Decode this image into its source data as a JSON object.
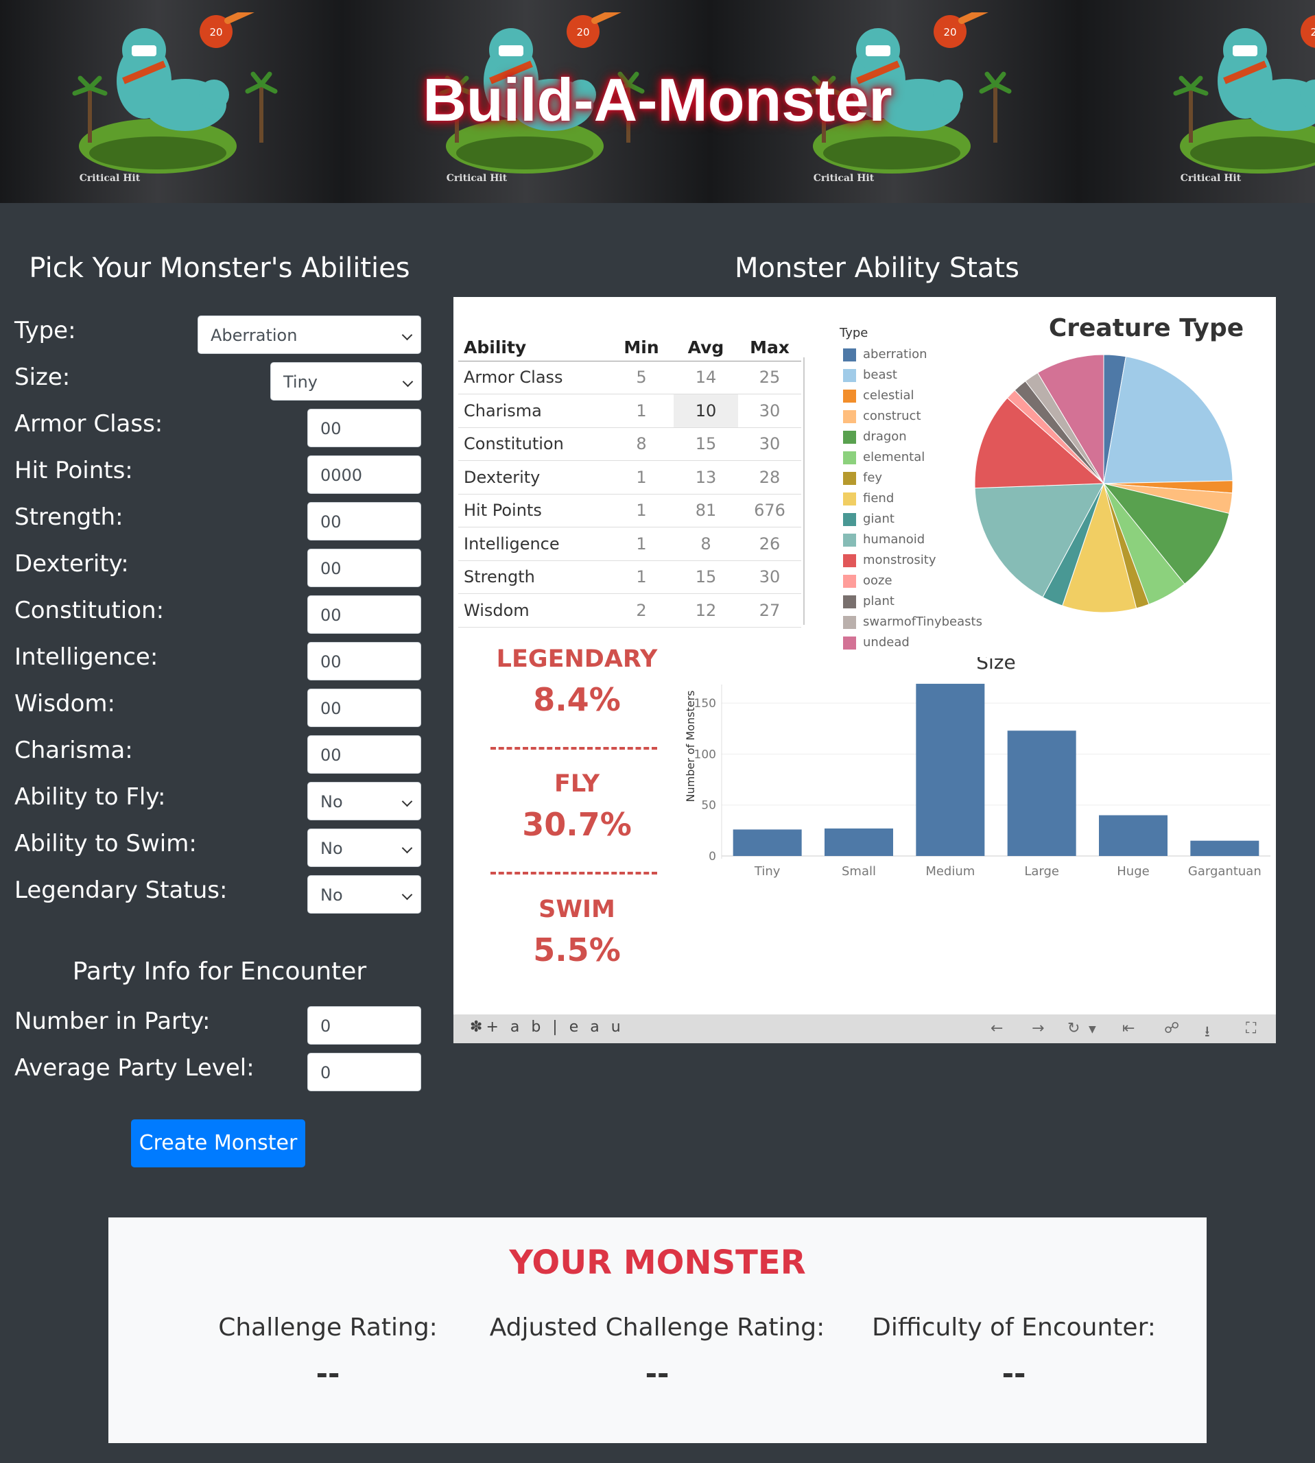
{
  "banner": {
    "title": "Build-A-Monster",
    "tile_caption": "Critical Hit",
    "die_label": "20"
  },
  "form": {
    "heading": "Pick Your Monster's Abilities",
    "fields": [
      {
        "label": "Type:",
        "value": "Aberration",
        "kind": "select"
      },
      {
        "label": "Size:",
        "value": "Tiny",
        "kind": "select"
      },
      {
        "label": "Armor Class:",
        "placeholder": "00",
        "kind": "input"
      },
      {
        "label": "Hit Points:",
        "placeholder": "0000",
        "kind": "input"
      },
      {
        "label": "Strength:",
        "placeholder": "00",
        "kind": "input"
      },
      {
        "label": "Dexterity:",
        "placeholder": "00",
        "kind": "input"
      },
      {
        "label": "Constitution:",
        "placeholder": "00",
        "kind": "input"
      },
      {
        "label": "Intelligence:",
        "placeholder": "00",
        "kind": "input"
      },
      {
        "label": "Wisdom:",
        "placeholder": "00",
        "kind": "input"
      },
      {
        "label": "Charisma:",
        "placeholder": "00",
        "kind": "input"
      },
      {
        "label": "Ability to Fly:",
        "value": "No",
        "kind": "select"
      },
      {
        "label": "Ability to Swim:",
        "value": "No",
        "kind": "select"
      },
      {
        "label": "Legendary Status:",
        "value": "No",
        "kind": "select"
      }
    ],
    "party_heading": "Party Info for Encounter",
    "party_fields": [
      {
        "label": "Number in Party:",
        "placeholder": "0"
      },
      {
        "label": "Average Party Level:",
        "placeholder": "0"
      }
    ],
    "submit_label": "Create Monster"
  },
  "stats": {
    "heading": "Monster Ability Stats",
    "table": {
      "columns": [
        "Ability",
        "Min",
        "Avg",
        "Max"
      ],
      "rows": [
        [
          "Armor Class",
          "5",
          "14",
          "25"
        ],
        [
          "Charisma",
          "1",
          "10",
          "30"
        ],
        [
          "Constitution",
          "8",
          "15",
          "30"
        ],
        [
          "Dexterity",
          "1",
          "13",
          "28"
        ],
        [
          "Hit Points",
          "1",
          "81",
          "676"
        ],
        [
          "Intelligence",
          "1",
          "8",
          "26"
        ],
        [
          "Strength",
          "1",
          "15",
          "30"
        ],
        [
          "Wisdom",
          "2",
          "12",
          "27"
        ]
      ]
    },
    "kpis": [
      {
        "title": "LEGENDARY",
        "value": "8.4%"
      },
      {
        "title": "FLY",
        "value": "30.7%"
      },
      {
        "title": "SWIM",
        "value": "5.5%"
      }
    ],
    "toolbar": {
      "logo": "+ a b | e a u"
    }
  },
  "chart_data": [
    {
      "type": "pie",
      "title": "Creature Type",
      "legend_title": "Type",
      "legend_position": "left",
      "categories": [
        "aberration",
        "beast",
        "celestial",
        "construct",
        "dragon",
        "elemental",
        "fey",
        "fiend",
        "giant",
        "humanoid",
        "monstrosity",
        "ooze",
        "plant",
        "swarmofTinybeasts",
        "undead"
      ],
      "values": [
        2.7,
        21.5,
        1.5,
        2.5,
        10.3,
        5.0,
        1.6,
        9.1,
        2.6,
        16.3,
        11.9,
        1.3,
        1.7,
        1.8,
        8.4
      ],
      "colors": [
        "#4e79a7",
        "#a0cbe8",
        "#f28e2b",
        "#ffbe7d",
        "#59a14f",
        "#8cd17d",
        "#b6992d",
        "#f1ce63",
        "#499894",
        "#86bcb6",
        "#e15759",
        "#ff9d9a",
        "#79706e",
        "#bab0ac",
        "#d37295"
      ]
    },
    {
      "type": "bar",
      "title": "Size",
      "xlabel": "",
      "ylabel": "Number of Monsters",
      "categories": [
        "Tiny",
        "Small",
        "Medium",
        "Large",
        "Huge",
        "Gargantuan"
      ],
      "values": [
        26,
        27,
        169,
        123,
        40,
        15
      ],
      "ylim": [
        0,
        175
      ],
      "yticks": [
        0,
        50,
        100,
        150
      ],
      "grid": true,
      "color": "#4e79a7"
    }
  ],
  "result": {
    "title": "YOUR MONSTER",
    "items": [
      {
        "label": "Challenge Rating:",
        "value": "--"
      },
      {
        "label": "Adjusted Challenge Rating:",
        "value": "--"
      },
      {
        "label": "Difficulty of Encounter:",
        "value": "--"
      }
    ]
  }
}
